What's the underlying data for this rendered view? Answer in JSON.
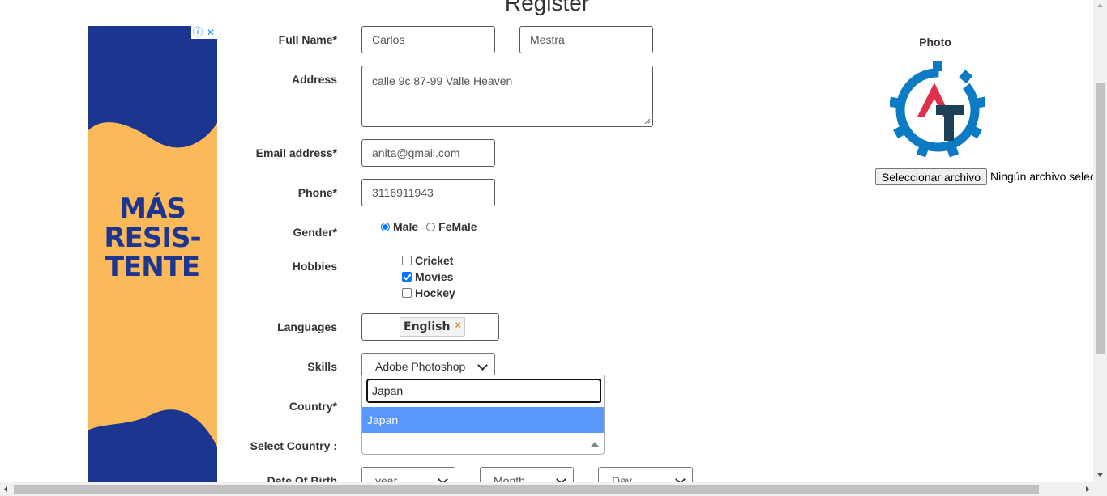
{
  "page": {
    "title": "Register"
  },
  "form": {
    "full_name_label": "Full Name*",
    "first_name": "Carlos",
    "last_name": "Mestra",
    "address_label": "Address",
    "address": "calle 9c 87-99 Valle Heaven",
    "email_label": "Email address*",
    "email": "anita@gmail.com",
    "phone_label": "Phone*",
    "phone": "3116911943",
    "gender_label": "Gender*",
    "gender_options": [
      "Male",
      "FeMale"
    ],
    "gender_selected": "Male",
    "hobbies_label": "Hobbies",
    "hobbies": [
      {
        "label": "Cricket",
        "checked": false
      },
      {
        "label": "Movies",
        "checked": true
      },
      {
        "label": "Hockey",
        "checked": false
      }
    ],
    "languages_label": "Languages",
    "language_tag": "English",
    "language_tag_remove": "×",
    "skills_label": "Skills",
    "skills_value": "Adobe Photoshop",
    "country_label": "Country*",
    "country_search": "Japan",
    "country_option": "Japan",
    "select_country_label": "Select Country :",
    "dob_label": "Date Of Birth",
    "dob_year": "year",
    "dob_month": "Month",
    "dob_day": "Day"
  },
  "photo": {
    "label": "Photo",
    "file_button": "Seleccionar archivo",
    "file_status": "Ningún archivo seleccionado"
  },
  "ad": {
    "headline_1": "MÁS",
    "headline_2": "RESIS-",
    "headline_3": "TENTE",
    "info_icon": "ⓘ",
    "close_icon": "✕",
    "colors": {
      "bg": "#fbb95a",
      "wave": "#1b3591"
    }
  },
  "colors": {
    "highlight": "#4f94ef",
    "gear": "#0d7bc4",
    "logo_red": "#e0304a",
    "logo_navy": "#1d4058"
  }
}
